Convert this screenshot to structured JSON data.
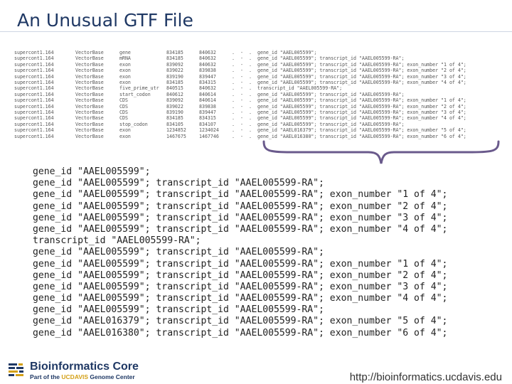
{
  "slide": {
    "title": "An Unusual GTF File"
  },
  "small_table": {
    "rows": [
      [
        "supercont1.164",
        "VectorBase",
        "gene",
        "834185",
        "840632",
        ".",
        "-",
        ".",
        "gene_id \"AAEL005599\";"
      ],
      [
        "supercont1.164",
        "VectorBase",
        "mRNA",
        "834185",
        "840632",
        ".",
        "-",
        ".",
        "gene_id \"AAEL005599\"; transcript_id \"AAEL005599-RA\";"
      ],
      [
        "supercont1.164",
        "VectorBase",
        "exon",
        "839092",
        "840632",
        ".",
        "-",
        ".",
        "gene_id \"AAEL005599\"; transcript_id \"AAEL005599-RA\"; exon_number \"1 of 4\";"
      ],
      [
        "supercont1.164",
        "VectorBase",
        "exon",
        "839022",
        "839838",
        ".",
        "-",
        ".",
        "gene_id \"AAEL005599\"; transcript_id \"AAEL005599-RA\"; exon_number \"2 of 4\";"
      ],
      [
        "supercont1.164",
        "VectorBase",
        "exon",
        "839190",
        "839447",
        ".",
        "-",
        ".",
        "gene_id \"AAEL005599\"; transcript_id \"AAEL005599-RA\"; exon_number \"3 of 4\";"
      ],
      [
        "supercont1.164",
        "VectorBase",
        "exon",
        "834185",
        "834315",
        ".",
        "-",
        ".",
        "gene_id \"AAEL005599\"; transcript_id \"AAEL005599-RA\"; exon_number \"4 of 4\";"
      ],
      [
        "supercont1.164",
        "VectorBase",
        "five_prime_utr",
        "840515",
        "840632",
        ".",
        "-",
        ".",
        "transcript_id \"AAEL005599-RA\";"
      ],
      [
        "supercont1.164",
        "VectorBase",
        "start_codon",
        "840612",
        "840614",
        ".",
        "-",
        ".",
        "gene_id \"AAEL005599\"; transcript_id \"AAEL005599-RA\";"
      ],
      [
        "supercont1.164",
        "VectorBase",
        "CDS",
        "839092",
        "840614",
        ".",
        "-",
        ".",
        "gene_id \"AAEL005599\"; transcript_id \"AAEL005599-RA\"; exon_number \"1 of 4\";"
      ],
      [
        "supercont1.164",
        "VectorBase",
        "CDS",
        "839022",
        "839838",
        ".",
        "-",
        ".",
        "gene_id \"AAEL005599\"; transcript_id \"AAEL005599-RA\"; exon_number \"2 of 4\";"
      ],
      [
        "supercont1.164",
        "VectorBase",
        "CDS",
        "839190",
        "839447",
        ".",
        "-",
        ".",
        "gene_id \"AAEL005599\"; transcript_id \"AAEL005599-RA\"; exon_number \"3 of 4\";"
      ],
      [
        "supercont1.164",
        "VectorBase",
        "CDS",
        "834185",
        "834315",
        ".",
        "-",
        ".",
        "gene_id \"AAEL005599\"; transcript_id \"AAEL005599-RA\"; exon_number \"4 of 4\";"
      ],
      [
        "supercont1.164",
        "VectorBase",
        "stop_codon",
        "834105",
        "834107",
        ".",
        "-",
        ".",
        "gene_id \"AAEL005599\"; transcript_id \"AAEL005599-RA\";"
      ],
      [
        "supercont1.164",
        "VectorBase",
        "exon",
        "1234852",
        "1234024",
        ".",
        "-",
        ".",
        "gene_id \"AAEL016379\"; transcript_id \"AAEL005599-RA\"; exon_number \"5 of 4\";"
      ],
      [
        "supercont1.164",
        "VectorBase",
        "exon",
        "1467675",
        "1467746",
        ".",
        "-",
        ".",
        "gene_id \"AAEL016380\"; transcript_id \"AAEL005599-RA\"; exon_number \"6 of 4\";"
      ]
    ]
  },
  "zoomed_attributes": {
    "lines": [
      "gene_id \"AAEL005599\";",
      "gene_id \"AAEL005599\"; transcript_id \"AAEL005599-RA\";",
      "gene_id \"AAEL005599\"; transcript_id \"AAEL005599-RA\"; exon_number \"1 of 4\";",
      "gene_id \"AAEL005599\"; transcript_id \"AAEL005599-RA\"; exon_number \"2 of 4\";",
      "gene_id \"AAEL005599\"; transcript_id \"AAEL005599-RA\"; exon_number \"3 of 4\";",
      "gene_id \"AAEL005599\"; transcript_id \"AAEL005599-RA\"; exon_number \"4 of 4\";",
      "transcript_id \"AAEL005599-RA\";",
      "gene_id \"AAEL005599\"; transcript_id \"AAEL005599-RA\";",
      "gene_id \"AAEL005599\"; transcript_id \"AAEL005599-RA\"; exon_number \"1 of 4\";",
      "gene_id \"AAEL005599\"; transcript_id \"AAEL005599-RA\"; exon_number \"2 of 4\";",
      "gene_id \"AAEL005599\"; transcript_id \"AAEL005599-RA\"; exon_number \"3 of 4\";",
      "gene_id \"AAEL005599\"; transcript_id \"AAEL005599-RA\"; exon_number \"4 of 4\";",
      "gene_id \"AAEL005599\"; transcript_id \"AAEL005599-RA\";",
      "gene_id \"AAEL016379\"; transcript_id \"AAEL005599-RA\"; exon_number \"5 of 4\";",
      "gene_id \"AAEL016380\"; transcript_id \"AAEL005599-RA\"; exon_number \"6 of 4\";"
    ]
  },
  "footer": {
    "logo_title": "Bioinformatics Core",
    "logo_sub_prefix": "Part of the ",
    "logo_sub_accent": "UCDAVIS",
    "logo_sub_suffix": " Genome Center",
    "url": "http://bioinformatics.ucdavis.edu"
  },
  "colors": {
    "title": "#1f3864",
    "brace": "#6a5a8c",
    "logo_accent": "#d4a017"
  },
  "icons": {
    "logo": "bioinformatics-logo-icon",
    "brace": "curly-brace-icon"
  }
}
